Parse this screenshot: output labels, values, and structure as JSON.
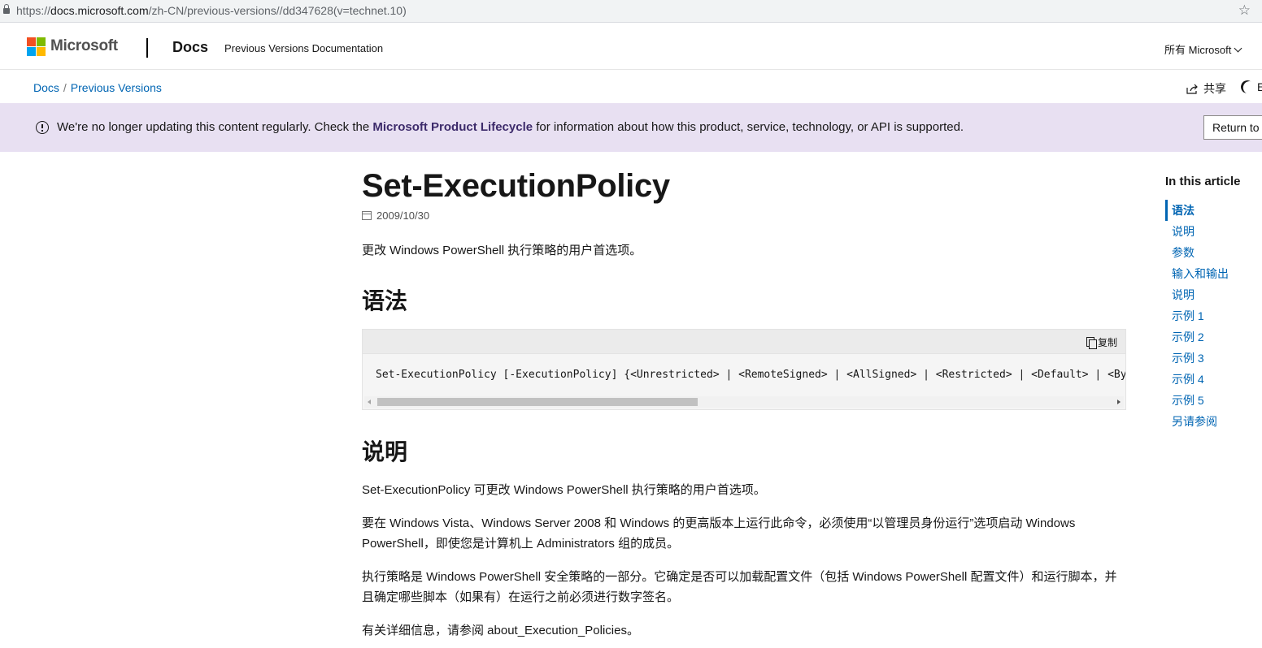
{
  "browser": {
    "url_prefix": "https://",
    "url_host": "docs.microsoft.com",
    "url_path": "/zh-CN/previous-versions//dd347628(v=technet.10)",
    "star_icon": "star-icon"
  },
  "header": {
    "brand": "Microsoft",
    "docs_label": "Docs",
    "previous_versions_label": "Previous Versions Documentation",
    "all_microsoft_label": "所有 Microsoft"
  },
  "breadcrumb": {
    "items": [
      "Docs",
      "Previous Versions"
    ],
    "separator": "/"
  },
  "actions": {
    "share_label": "共享",
    "theme_label_partial": "E"
  },
  "banner": {
    "text_before": "We're no longer updating this content regularly. Check the ",
    "link_text": "Microsoft Product Lifecycle",
    "text_after": " for information about how this product, service, technology, or API is supported.",
    "button_label": "Return to"
  },
  "article": {
    "title": "Set-ExecutionPolicy",
    "date": "2009/10/30",
    "intro": "更改 Windows PowerShell 执行策略的用户首选项。",
    "syntax_heading": "语法",
    "copy_label": "复制",
    "code": "Set-ExecutionPolicy [-ExecutionPolicy] {<Unrestricted> | <RemoteSigned> | <AllSigned> | <Restricted> | <Default> | <Bypa",
    "description_heading": "说明",
    "paragraphs": [
      "Set-ExecutionPolicy 可更改 Windows PowerShell 执行策略的用户首选项。",
      "要在 Windows Vista、Windows Server 2008 和 Windows 的更高版本上运行此命令，必须使用“以管理员身份运行”选项启动 Windows PowerShell，即使您是计算机上 Administrators 组的成员。",
      "执行策略是 Windows PowerShell 安全策略的一部分。它确定是否可以加载配置文件（包括 Windows PowerShell 配置文件）和运行脚本，并且确定哪些脚本（如果有）在运行之前必须进行数字签名。",
      "有关详细信息，请参阅 about_Execution_Policies。"
    ]
  },
  "toc": {
    "title": "In this article",
    "items": [
      "语法",
      "说明",
      "参数",
      "输入和输出",
      "说明",
      "示例 1",
      "示例 2",
      "示例 3",
      "示例 4",
      "示例 5",
      "另请参阅"
    ],
    "active_index": 0
  },
  "colors": {
    "link": "#0065b3",
    "banner_bg": "#e8e0f2",
    "banner_link": "#3d2b6b"
  }
}
